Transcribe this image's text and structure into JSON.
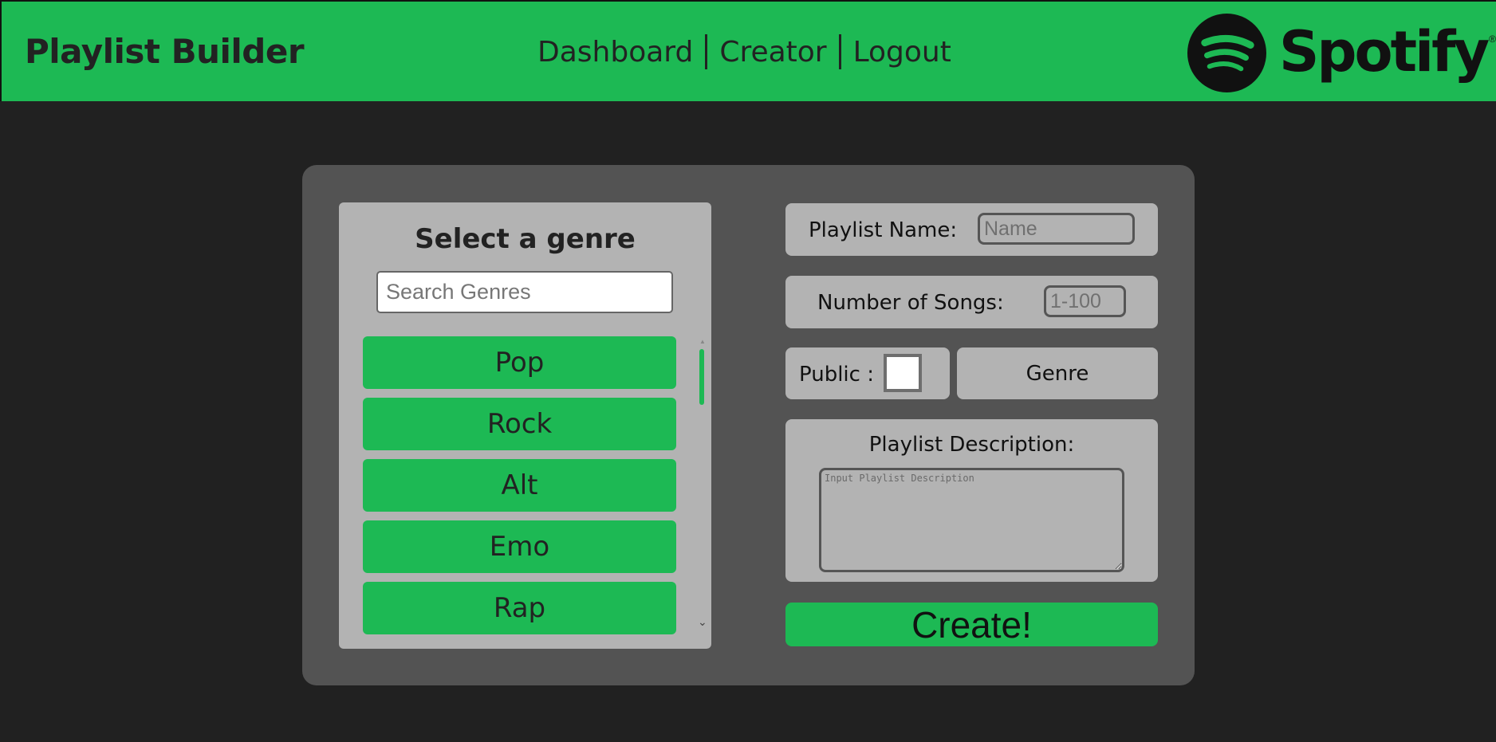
{
  "app_title": "Playlist Builder",
  "nav": {
    "dashboard": "Dashboard",
    "creator": "Creator",
    "logout": "Logout"
  },
  "logo": {
    "icon": "spotify-icon",
    "wordmark": "Spotify",
    "registered": "®"
  },
  "colors": {
    "brand_green": "#1db954",
    "background": "#212121",
    "panel": "#535353",
    "box": "#b3b3b3"
  },
  "genre_panel": {
    "title": "Select a genre",
    "search_placeholder": "Search Genres",
    "genres": [
      "Pop",
      "Rock",
      "Alt",
      "Emo",
      "Rap"
    ]
  },
  "form": {
    "playlist_name_label": "Playlist Name:",
    "playlist_name_placeholder": "Name",
    "num_songs_label": "Number of Songs:",
    "num_songs_placeholder": "1-100",
    "public_label": "Public :",
    "public_checked": false,
    "genre_button": "Genre",
    "description_label": "Playlist Description:",
    "description_placeholder": "Input Playlist Description",
    "create_button": "Create!"
  }
}
